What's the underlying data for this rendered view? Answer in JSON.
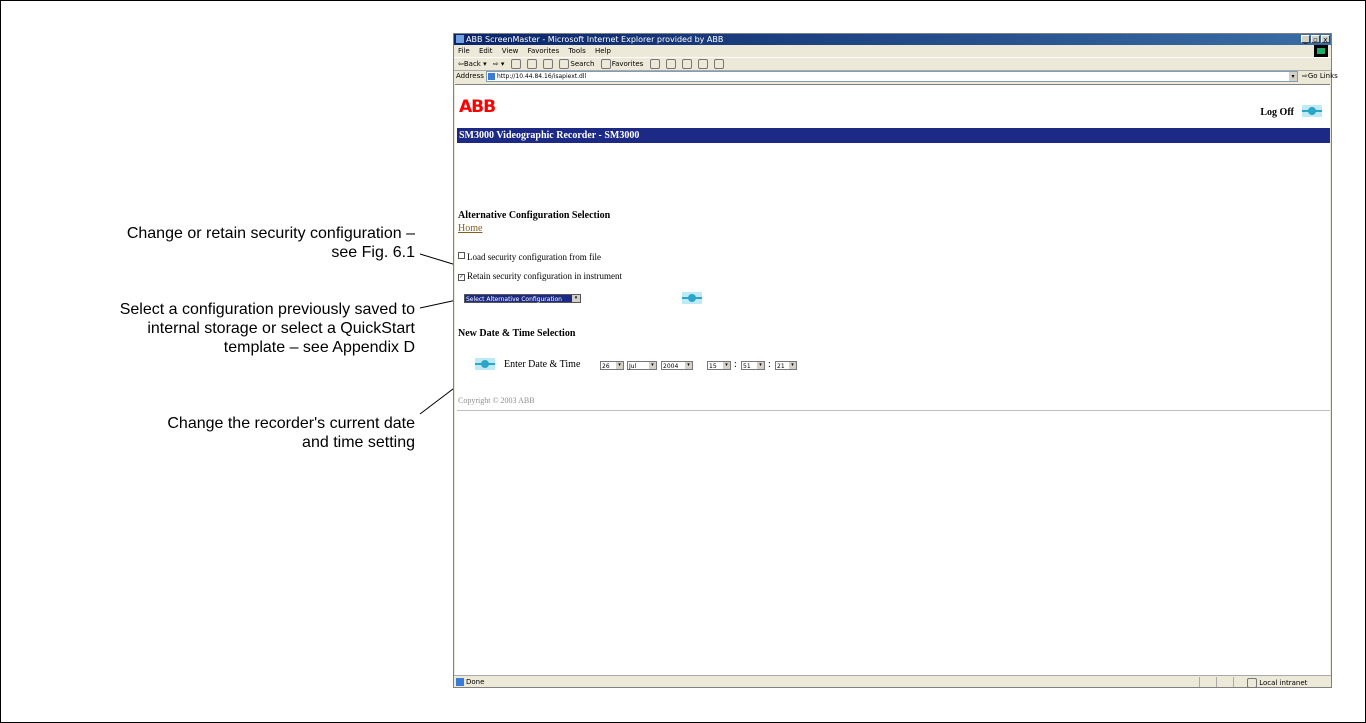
{
  "callouts": {
    "security_line1": "Change or retain security configuration –",
    "security_line2": "see Fig. 6.1",
    "config_line1": "Select a configuration previously saved to",
    "config_line2": "internal storage or select a QuickStart",
    "config_line3": "template – see Appendix D",
    "datetime_line1": "Change the recorder's current date",
    "datetime_line2": "and time setting"
  },
  "browser": {
    "title": "ABB ScreenMaster - Microsoft Internet Explorer provided by ABB",
    "window_buttons": [
      "_",
      "Ő",
      "x"
    ],
    "menu": [
      "File",
      "Edit",
      "View",
      "Favorites",
      "Tools",
      "Help"
    ],
    "toolbar": {
      "back": "⇦Back ▾",
      "forward": "⇨ ▾",
      "search": "Search",
      "favorites": "Favorites"
    },
    "address_label": "Address",
    "address_value": "http://10.44.84.16/isapiext.dll",
    "go_label": "⇨Go",
    "links_label": "Links",
    "status_text": "Done",
    "zone_text": "Local intranet"
  },
  "page": {
    "logo": "ABB",
    "logoff_label": "Log Off",
    "header_title": "SM3000 Videographic Recorder - SM3000",
    "alt_config_heading": "Alternative Configuration Selection",
    "home_link": "Home",
    "option_load": "Load security configuration from file",
    "option_retain": "Retain security configuration in instrument",
    "option_load_checked": false,
    "option_retain_checked": true,
    "alt_config_select": "Select Alternative Configuration",
    "datetime_heading": "New Date & Time Selection",
    "datetime_label": "Enter Date & Time",
    "day": "26",
    "month": "Jul",
    "year": "2004",
    "hour": "15",
    "minute": "51",
    "second": "21",
    "colon": ":",
    "copyright": "Copyright © 2003 ABB"
  },
  "icons": {
    "system_icon": "system-config-icon",
    "page_icon": "ie-page-icon"
  }
}
